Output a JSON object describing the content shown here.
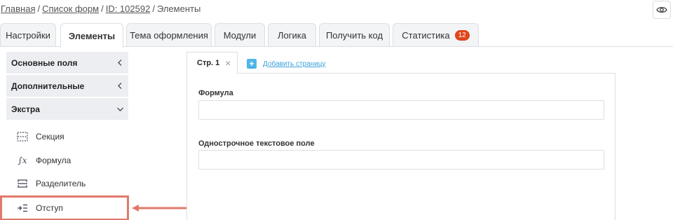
{
  "breadcrumb": {
    "home": "Главная",
    "forms": "Список форм",
    "id": "ID: 102592",
    "current": "Элементы"
  },
  "header": {
    "eye_icon": "eye-icon"
  },
  "tabs": [
    {
      "label": "Настройки"
    },
    {
      "label": "Элементы",
      "active": true
    },
    {
      "label": "Тема оформления"
    },
    {
      "label": "Модули"
    },
    {
      "label": "Логика"
    },
    {
      "label": "Получить код"
    },
    {
      "label": "Статистика",
      "badge": "12"
    }
  ],
  "sidebar": {
    "groups": [
      {
        "label": "Основные поля",
        "state": "collapsed"
      },
      {
        "label": "Дополнительные",
        "state": "collapsed"
      },
      {
        "label": "Экстра",
        "state": "expanded"
      }
    ],
    "items": [
      {
        "label": "Секция",
        "icon": "section-icon"
      },
      {
        "label": "Формула",
        "icon": "formula-icon"
      },
      {
        "label": "Разделитель",
        "icon": "divider-icon"
      },
      {
        "label": "Отступ",
        "icon": "indent-icon"
      }
    ]
  },
  "editor": {
    "page_tab": "Стр. 1",
    "add_page": "Добавить страницу",
    "fields": [
      {
        "label": "Формула",
        "value": ""
      },
      {
        "label": "Однострочное текстовое поле",
        "value": ""
      }
    ]
  },
  "colors": {
    "highlight": "#e07a6b",
    "badge": "#e0451b",
    "link": "#3aa0d8"
  }
}
